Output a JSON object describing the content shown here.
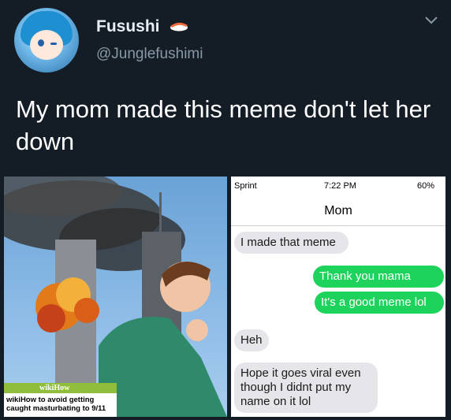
{
  "tweet": {
    "display_name": "Fusushi",
    "handle": "@Junglefushimi",
    "text": "My mom made this meme don't let her down"
  },
  "left_image": {
    "wiki_logo": "wikiHow",
    "caption": "wikiHow to avoid getting caught masturbating to 9/11",
    "accent": "#8fbf3a"
  },
  "phone": {
    "carrier": "Sprint",
    "time": "7:22 PM",
    "battery": "60%",
    "contact": "Mom",
    "messages": [
      {
        "from": "me",
        "text": "I made that meme"
      },
      {
        "from": "them",
        "text": "Thank you mama"
      },
      {
        "from": "them",
        "text": "It's a good meme lol"
      },
      {
        "from": "me",
        "text": "Heh"
      },
      {
        "from": "me",
        "text": "Hope it goes viral even though I didnt put my name on it lol"
      }
    ],
    "colors": {
      "incoming": "#e5e5ea",
      "outgoing": "#1ed35c"
    }
  },
  "colors": {
    "background": "#141d26",
    "handle": "#8899a6"
  }
}
